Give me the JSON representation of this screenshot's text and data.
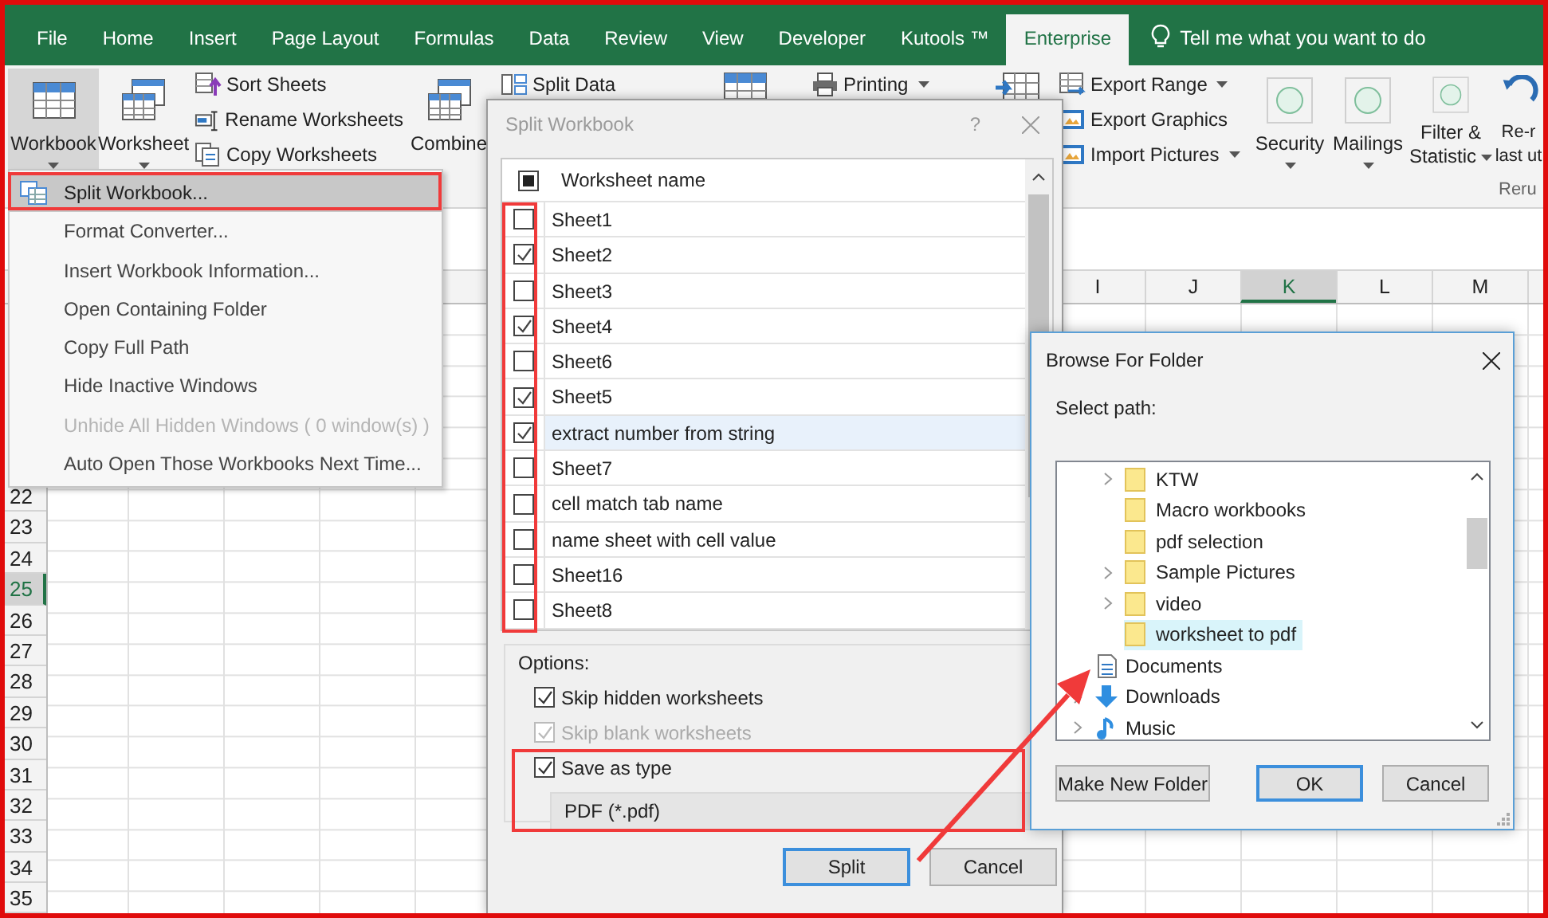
{
  "tabs": [
    {
      "label": "File",
      "selected": false
    },
    {
      "label": "Home",
      "selected": false
    },
    {
      "label": "Insert",
      "selected": false
    },
    {
      "label": "Page Layout",
      "selected": false
    },
    {
      "label": "Formulas",
      "selected": false
    },
    {
      "label": "Data",
      "selected": false
    },
    {
      "label": "Review",
      "selected": false
    },
    {
      "label": "View",
      "selected": false
    },
    {
      "label": "Developer",
      "selected": false
    },
    {
      "label": "Kutools ™",
      "selected": false
    },
    {
      "label": "Enterprise",
      "selected": true
    }
  ],
  "tell_me": "Tell me what you want to do",
  "ribbon": [
    {
      "kind": "large",
      "lines": [
        "Workbook"
      ],
      "caret": true,
      "pressed": true
    },
    {
      "kind": "large",
      "lines": [
        "Worksheet"
      ],
      "caret": true,
      "pressed": false
    },
    {
      "kind": "stack",
      "items": [
        {
          "label": "Sort Sheets"
        },
        {
          "label": "Rename Worksheets"
        },
        {
          "label": "Copy Worksheets"
        }
      ]
    },
    {
      "kind": "large",
      "lines": [
        "Combine"
      ],
      "pressed": false
    },
    {
      "kind": "stack",
      "items": [
        {
          "label": "Split Data"
        }
      ]
    },
    {
      "kind": "large"
    },
    {
      "kind": "stack",
      "items": [
        {
          "label": "Printing",
          "caret": true
        }
      ]
    },
    {
      "kind": "large"
    },
    {
      "kind": "stack",
      "items": [
        {
          "label": "Export Range",
          "caret": true
        },
        {
          "label": "Export Graphics"
        },
        {
          "label": "Import Pictures",
          "caret": true
        }
      ]
    },
    {
      "kind": "large",
      "lines": [
        "Security"
      ],
      "caret": true,
      "pressed": false
    },
    {
      "kind": "large",
      "lines": [
        "Mailings"
      ],
      "caret": true,
      "pressed": false
    },
    {
      "kind": "large",
      "lines": [
        "Filter &",
        "Statistic"
      ],
      "caret": true,
      "pressed": false
    },
    {
      "kind": "large",
      "lines": [
        "Re-r",
        "last ut"
      ],
      "pressed": false,
      "group": "Reru"
    }
  ],
  "sheet": {
    "columns": [
      {
        "label": "I",
        "selected": false
      },
      {
        "label": "J",
        "selected": false
      },
      {
        "label": "K",
        "selected": true
      },
      {
        "label": "L",
        "selected": false
      },
      {
        "label": "M",
        "selected": false
      }
    ],
    "rows": [
      {
        "label": "22",
        "selected": false
      },
      {
        "label": "23",
        "selected": false
      },
      {
        "label": "24",
        "selected": false
      },
      {
        "label": "25",
        "selected": true
      },
      {
        "label": "26",
        "selected": false
      },
      {
        "label": "27",
        "selected": false
      },
      {
        "label": "28",
        "selected": false
      },
      {
        "label": "29",
        "selected": false
      },
      {
        "label": "30",
        "selected": false
      },
      {
        "label": "31",
        "selected": false
      },
      {
        "label": "32",
        "selected": false
      },
      {
        "label": "33",
        "selected": false
      },
      {
        "label": "34",
        "selected": false
      },
      {
        "label": "35",
        "selected": false
      }
    ]
  },
  "menu": [
    {
      "label": "Split Workbook...",
      "selected": true,
      "disabled": false
    },
    {
      "label": "Format Converter...",
      "selected": false,
      "disabled": false
    },
    {
      "label": "Insert Workbook Information...",
      "selected": false,
      "disabled": false
    },
    {
      "label": "Open Containing Folder",
      "selected": false,
      "disabled": false
    },
    {
      "label": "Copy Full Path",
      "selected": false,
      "disabled": false
    },
    {
      "label": "Hide Inactive Windows",
      "selected": false,
      "disabled": false
    },
    {
      "label": "Unhide All Hidden Windows ( 0 window(s) )",
      "selected": false,
      "disabled": true
    },
    {
      "label": "Auto Open Those Workbooks Next Time...",
      "selected": false,
      "disabled": false
    }
  ],
  "split_dialog": {
    "title": "Split Workbook",
    "help": "?",
    "header": "Worksheet name",
    "header_partial": true,
    "sheets": [
      {
        "name": "Sheet1",
        "checked": false,
        "selected": false
      },
      {
        "name": "Sheet2",
        "checked": true,
        "selected": false
      },
      {
        "name": "Sheet3",
        "checked": false,
        "selected": false
      },
      {
        "name": "Sheet4",
        "checked": true,
        "selected": false
      },
      {
        "name": "Sheet6",
        "checked": false,
        "selected": false
      },
      {
        "name": "Sheet5",
        "checked": true,
        "selected": false
      },
      {
        "name": "extract number from string",
        "checked": true,
        "selected": true
      },
      {
        "name": "Sheet7",
        "checked": false,
        "selected": false
      },
      {
        "name": "cell match tab name",
        "checked": false,
        "selected": false
      },
      {
        "name": "name sheet with cell value",
        "checked": false,
        "selected": false
      },
      {
        "name": "Sheet16",
        "checked": false,
        "selected": false
      },
      {
        "name": "Sheet8",
        "checked": false,
        "selected": false
      }
    ],
    "options_label": "Options:",
    "options": [
      {
        "label": "Skip hidden worksheets",
        "checked": true,
        "disabled": false
      },
      {
        "label": "Skip blank worksheets",
        "checked": true,
        "disabled": true
      },
      {
        "label": "Save as type",
        "checked": true,
        "disabled": false
      }
    ],
    "save_type": "PDF (*.pdf)",
    "buttons": [
      {
        "label": "Split",
        "default": true
      },
      {
        "label": "Cancel",
        "default": false
      }
    ]
  },
  "browse_dialog": {
    "title": "Browse For Folder",
    "prompt": "Select path:",
    "tree": [
      {
        "children": [
          {
            "label": "KTW",
            "kind": "folder",
            "expandable": true,
            "selected": false
          },
          {
            "label": "Macro workbooks",
            "kind": "folder",
            "expandable": false,
            "selected": false
          },
          {
            "label": "pdf selection",
            "kind": "folder",
            "expandable": false,
            "selected": false
          },
          {
            "label": "Sample Pictures",
            "kind": "folder",
            "expandable": true,
            "selected": false
          },
          {
            "label": "video",
            "kind": "folder",
            "expandable": true,
            "selected": false
          },
          {
            "label": "worksheet to pdf",
            "kind": "folder",
            "expandable": false,
            "selected": true
          }
        ]
      },
      {
        "label": "Documents",
        "kind": "documents",
        "expandable": false,
        "selected": false
      },
      {
        "label": "Downloads",
        "kind": "downloads",
        "expandable": true,
        "selected": false
      },
      {
        "label": "Music",
        "kind": "music",
        "expandable": true,
        "selected": false
      }
    ],
    "buttons": [
      {
        "label": "Make New Folder",
        "default": false
      },
      {
        "label": "OK",
        "default": true
      },
      {
        "label": "Cancel",
        "default": false
      }
    ]
  }
}
